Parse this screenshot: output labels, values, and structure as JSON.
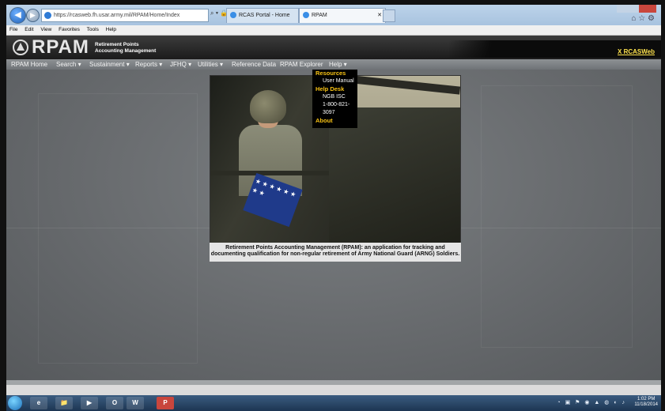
{
  "browser": {
    "address": "https://rcasweb.fh.usar.army.mil/RPAM/Home/Index",
    "address_controls": "⌕ ▾ 🔒 C ✕",
    "tabs": [
      {
        "label": "RCAS Portal - Home"
      },
      {
        "label": "RPAM"
      }
    ],
    "menu": [
      "File",
      "Edit",
      "View",
      "Favorites",
      "Tools",
      "Help"
    ],
    "toolbar_icons": "⌂ ☆ ⚙"
  },
  "app": {
    "logo": "RPAM",
    "logo_sub_line1": "Retirement Points",
    "logo_sub_line2": "Accounting Management",
    "header_link": "X RCASWeb",
    "nav": [
      {
        "label": "RPAM Home"
      },
      {
        "label": "Search ▾"
      },
      {
        "label": "Sustainment ▾"
      },
      {
        "label": "Reports ▾"
      },
      {
        "label": "JFHQ ▾"
      },
      {
        "label": "Utilities ▾"
      },
      {
        "label": "Reference Data"
      },
      {
        "label": "RPAM Explorer"
      },
      {
        "label": "Help ▾"
      }
    ],
    "help_menu": {
      "resources": "Resources",
      "user_manual": "User Manual",
      "help_desk": "Help Desk",
      "ngb_isc": "NGB ISC",
      "phone": "1-800-821-3097",
      "about": "About"
    },
    "caption": "Retirement Points Accounting Management (RPAM): an application for tracking and documenting qualification for non-regular retirement of Army National Guard (ARNG) Soldiers."
  },
  "taskbar": {
    "apps": [
      "e",
      "📁",
      "▶",
      "O",
      "W",
      "P"
    ],
    "tray": "◔ ▣ ⚑ ◉ ▲ ◍ ◐ ♪",
    "time": "1:02 PM",
    "date": "11/18/2014"
  }
}
